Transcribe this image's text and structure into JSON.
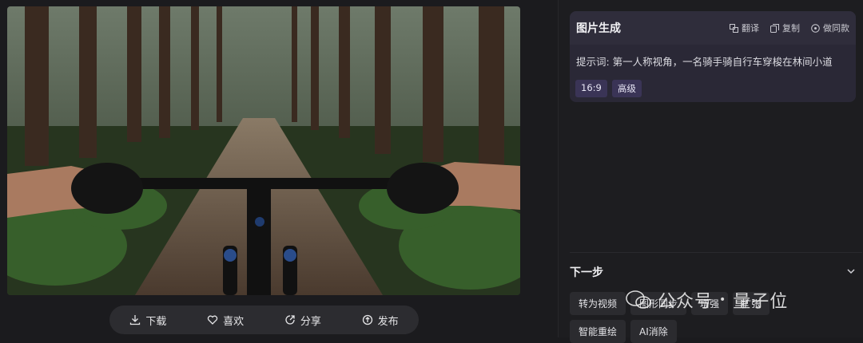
{
  "image": {
    "alt_icon": "forest-bike-photo"
  },
  "actions": [
    {
      "label": "下载",
      "icon": "download-icon"
    },
    {
      "label": "喜欢",
      "icon": "heart-icon"
    },
    {
      "label": "分享",
      "icon": "share-icon"
    },
    {
      "label": "发布",
      "icon": "publish-icon"
    }
  ],
  "gen_card": {
    "title": "图片生成",
    "translate": "翻译",
    "copy": "复制",
    "same_style": "做同款",
    "prompt": "提示词: 第一人称视角，一名骑手骑自行车穿梭在林间小道",
    "tags": [
      "16:9",
      "高级"
    ]
  },
  "next_step": {
    "title": "下一步",
    "row1": [
      "转为视频",
      "图形同步",
      "增强",
      "扩张"
    ],
    "row2": [
      "智能重绘",
      "AI消除"
    ]
  },
  "watermark": {
    "left": "公众号",
    "right": "量子位"
  },
  "colors": {
    "card_bg": "#2a2836",
    "tag_bg": "#3a3456",
    "page_bg": "#1b1b1e"
  }
}
